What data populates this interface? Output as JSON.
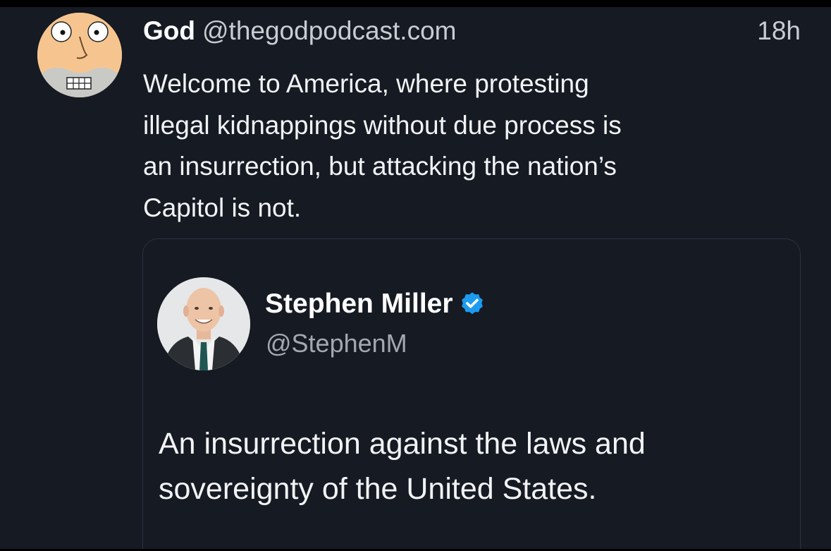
{
  "post": {
    "author_name": "God",
    "author_handle": "@thegodpodcast.com",
    "timestamp": "18h",
    "avatar_icon": "cartoon-face-avatar",
    "text_lines": [
      "Welcome to America, where protesting",
      "illegal kidnappings without due process is",
      "an insurrection, but attacking the nation’s",
      "Capitol is not."
    ]
  },
  "quoted_post": {
    "author_name": "Stephen Miller",
    "author_handle": "@StephenM",
    "verified_icon": "verified-badge-icon",
    "avatar_icon": "profile-photo-avatar",
    "text_lines": [
      "An insurrection against the laws and",
      "sovereignty of the United States."
    ]
  },
  "colors": {
    "background": "#151a23",
    "text_primary": "#f2f3f5",
    "text_secondary": "#a4a8b0",
    "verified_blue": "#1d9bf0",
    "card_border": "#2c3340"
  }
}
